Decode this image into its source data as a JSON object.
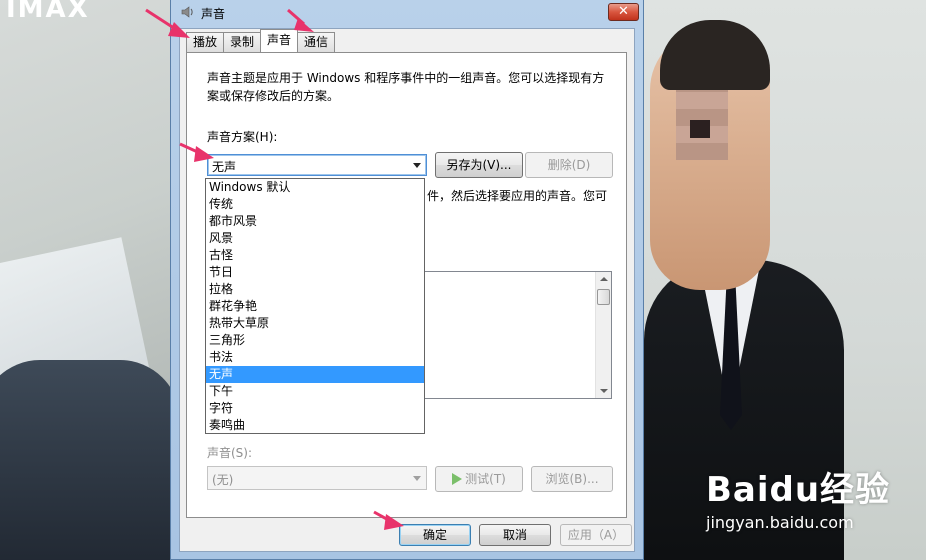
{
  "wallpaper": {
    "logo_text": "IMAX",
    "watermark_brand": "Baidu经验",
    "watermark_url": "jingyan.baidu.com"
  },
  "window": {
    "title": "声音",
    "close_glyph": "✕",
    "tabs": [
      {
        "label": "播放",
        "active": false
      },
      {
        "label": "录制",
        "active": false
      },
      {
        "label": "声音",
        "active": true
      },
      {
        "label": "通信",
        "active": false
      }
    ],
    "description": "声音主题是应用于 Windows 和程序事件中的一组声音。您可以选择现有方案或保存修改后的方案。",
    "scheme_label": "声音方案(H):",
    "scheme_value": "无声",
    "save_as_button": "另存为(V)...",
    "delete_button": "删除(D)",
    "hint_text": "件，然后选择要应用的声音。您可",
    "dropdown_options": [
      "Windows 默认",
      "传统",
      "都市风景",
      "风景",
      "古怪",
      "节日",
      "拉格",
      "群花争艳",
      "热带大草原",
      "三角形",
      "书法",
      "无声",
      "下午",
      "字符",
      "奏鸣曲"
    ],
    "dropdown_selected": "无声",
    "sound_label": "声音(S):",
    "sound_value": "(无)",
    "test_button": "测试(T)",
    "browse_button": "浏览(B)...",
    "ok_button": "确定",
    "cancel_button": "取消",
    "apply_button": "应用（A）"
  },
  "colors": {
    "selection": "#3399ff",
    "annotation_arrow": "#e8336b"
  }
}
